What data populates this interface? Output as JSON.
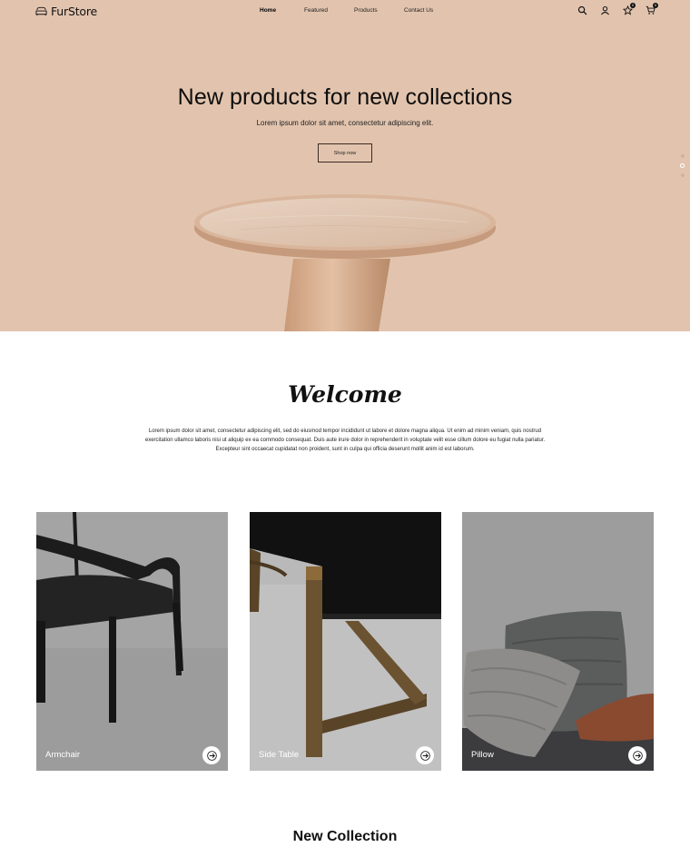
{
  "header": {
    "brand": "FurStore",
    "nav": [
      {
        "label": "Home",
        "active": true
      },
      {
        "label": "Featured",
        "active": false
      },
      {
        "label": "Products",
        "active": false
      },
      {
        "label": "Contact Us",
        "active": false
      }
    ],
    "icons": [
      "search-icon",
      "user-icon",
      "star-icon",
      "cart-icon"
    ],
    "favorites_count": "0",
    "cart_count": "0"
  },
  "hero": {
    "title": "New products for new collections",
    "subtitle": "Lorem ipsum dolor sit amet, consectetur adipiscing elit.",
    "button": "Shop now",
    "slide_dots": 3,
    "active_slide": 2,
    "background": "#e2c4ae"
  },
  "welcome": {
    "title": "Welcome",
    "text": "Lorem ipsum dolor sit amet, consectetur adipiscing elit, sed do eiusmod tempor incididunt ut labore et dolore magna aliqua. Ut enim ad minim veniam, quis nostrud exercitation ullamco laboris nisi ut aliquip ex ea commodo consequat. Duis aute irure dolor in reprehenderit in voluptate velit esse cillum dolore eu fugiat nulla pariatur. Excepteur sint occaecat cupidatat non proident, sunt in culpa qui officia deserunt mollit anim id est laborum."
  },
  "categories": [
    {
      "label": "Armchair"
    },
    {
      "label": "Side Table"
    },
    {
      "label": "Pillow"
    }
  ],
  "new_collection": {
    "title": "New Collection"
  }
}
